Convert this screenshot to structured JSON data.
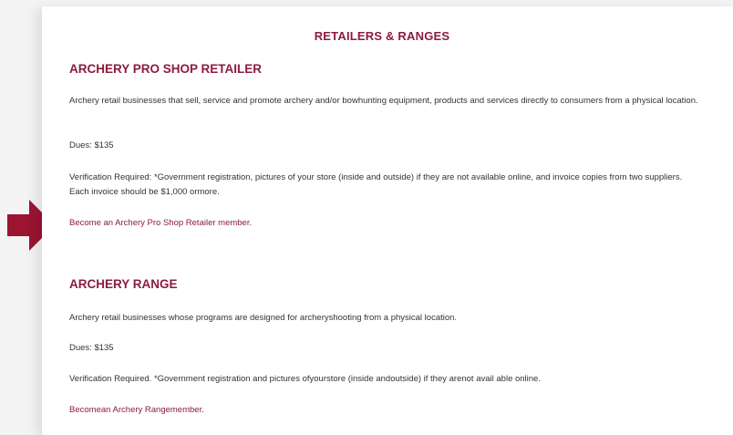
{
  "page": {
    "heading": "RETAILERS & RANGES"
  },
  "sections": [
    {
      "title": "ARCHERY PRO SHOP RETAILER",
      "description": "Archery retail businesses that sell, service and promote archery and/or bowhunting equipment, products and services directly to consumers from a physical location.",
      "dues": "Dues: $135",
      "verification": "Verification Required: *Government registration, pictures of your store (inside and outside) if they are not available online, and invoice copies from two suppliers. Each invoice should be $1,000 ormore.",
      "link": "Become an Archery Pro Shop Retailer member."
    },
    {
      "title": "ARCHERY RANGE",
      "description": "Archery retail businesses whose programs are designed for archeryshooting from a physical location.",
      "dues": "Dues: $135",
      "verification": "Verification Required. *Government registration and pictures ofyourstore (inside andoutside) if they arenot avail able online.",
      "link": "Becomean Archery Rangemember."
    }
  ],
  "colors": {
    "accent": "#8c1c3c",
    "arrow": "#9b1432",
    "text": "#333333"
  },
  "icons": {
    "pointer": "right-arrow-icon"
  }
}
